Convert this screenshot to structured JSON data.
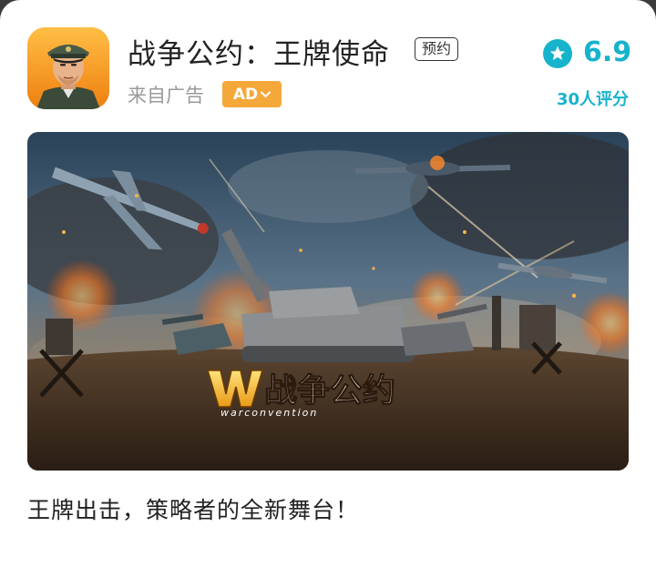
{
  "app": {
    "name": "战争公约：王牌使命",
    "reserve_tag": "预约",
    "source_label": "来自广告",
    "ad_badge": "AD",
    "icon": "soldier-avatar-icon"
  },
  "rating": {
    "icon": "star-icon",
    "score": "6.9",
    "count_label": "30人评分"
  },
  "banner": {
    "logo_text": "战争公约",
    "logo_sub": "warconvention"
  },
  "tagline": "王牌出击，策略者的全新舞台！",
  "colors": {
    "accent": "#17b3cc",
    "ad_badge": "#f5a83a",
    "title": "#222222",
    "muted": "#9a9a9a"
  }
}
